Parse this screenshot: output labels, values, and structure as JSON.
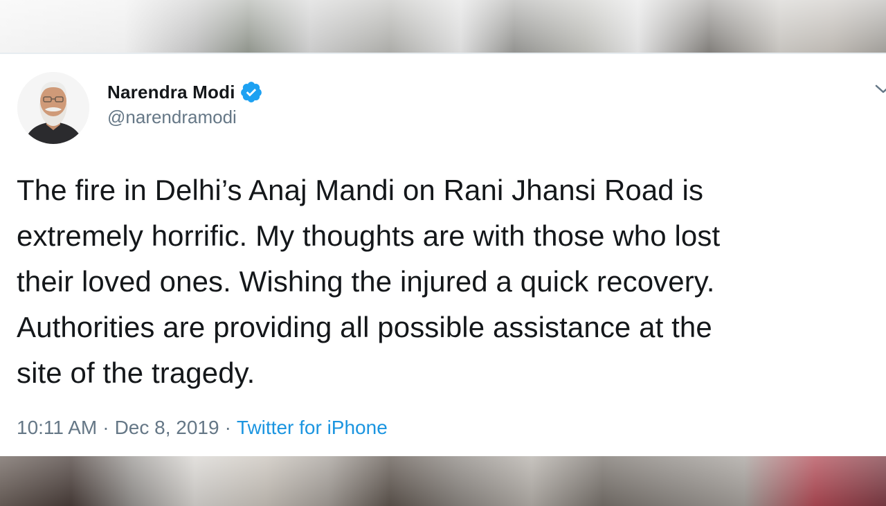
{
  "tweet": {
    "author_name": "Narendra Modi",
    "handle": "@narendramodi",
    "verified": true,
    "text": "The fire in Delhi’s Anaj Mandi on Rani Jhansi Road is\nextremely horrific. My thoughts are with those who lost\ntheir loved ones. Wishing the injured a quick recovery.\nAuthorities are providing all possible assistance at the\nsite of the tragedy.",
    "time": "10:11 AM",
    "date": "Dec 8, 2019",
    "separator": "·",
    "source": "Twitter for iPhone"
  },
  "icons": {
    "avatar": "profile-photo",
    "verified": "verified-badge-icon",
    "caret": "chevron-down-icon"
  },
  "colors": {
    "name": "#14171a",
    "secondary": "#657786",
    "link": "#1b95e0",
    "verified": "#1da1f2"
  }
}
